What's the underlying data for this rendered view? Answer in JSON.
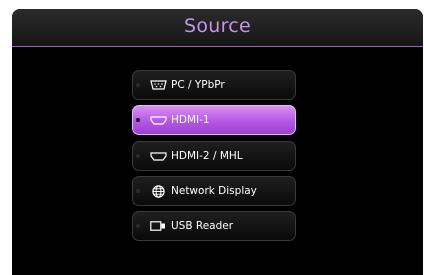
{
  "header": {
    "title": "Source"
  },
  "menu": {
    "items": [
      {
        "label": "PC / YPbPr",
        "icon": "vga-port-icon",
        "selected": false
      },
      {
        "label": "HDMI-1",
        "icon": "hdmi-port-icon",
        "selected": true
      },
      {
        "label": "HDMI-2 / MHL",
        "icon": "hdmi-port-icon",
        "selected": false
      },
      {
        "label": "Network Display",
        "icon": "globe-icon",
        "selected": false
      },
      {
        "label": "USB Reader",
        "icon": "usb-reader-icon",
        "selected": false
      }
    ]
  },
  "colors": {
    "accent": "#c792ea",
    "selected_fill": "#b458e3",
    "panel_bg": "#000000"
  }
}
